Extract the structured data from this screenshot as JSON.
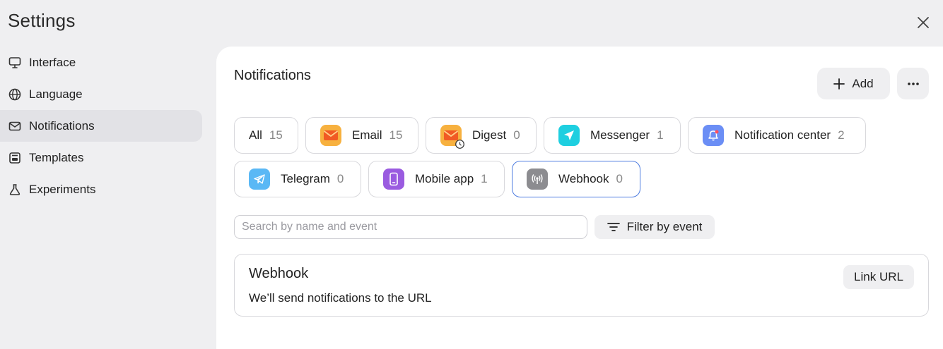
{
  "header": {
    "title": "Settings"
  },
  "sidebar": {
    "items": [
      {
        "label": "Interface",
        "icon": "monitor-icon"
      },
      {
        "label": "Language",
        "icon": "globe-icon"
      },
      {
        "label": "Notifications",
        "icon": "envelope-icon",
        "active": true
      },
      {
        "label": "Templates",
        "icon": "template-icon"
      },
      {
        "label": "Experiments",
        "icon": "flask-icon"
      }
    ]
  },
  "main": {
    "title": "Notifications",
    "add_label": "Add",
    "channels": [
      {
        "label": "All",
        "count": "15"
      },
      {
        "label": "Email",
        "count": "15",
        "icon": "email-icon",
        "color": "#f7b13f"
      },
      {
        "label": "Digest",
        "count": "0",
        "icon": "digest-icon",
        "color": "#f7b13f"
      },
      {
        "label": "Messenger",
        "count": "1",
        "icon": "messenger-icon",
        "color": "#1ecfe0"
      },
      {
        "label": "Notification center",
        "count": "2",
        "icon": "bell-icon",
        "color": "#6b8ef5"
      },
      {
        "label": "Telegram",
        "count": "0",
        "icon": "telegram-icon",
        "color": "#5ab8f5"
      },
      {
        "label": "Mobile app",
        "count": "1",
        "icon": "phone-icon",
        "color": "#9a5be0"
      },
      {
        "label": "Webhook",
        "count": "0",
        "icon": "webhook-icon",
        "color": "#8c8c90",
        "selected": true
      }
    ],
    "search": {
      "placeholder": "Search by name and event",
      "value": ""
    },
    "filter_label": "Filter by event",
    "card": {
      "title": "Webhook",
      "description": "We’ll send notifications to the URL",
      "link_label": "Link URL"
    }
  },
  "colors": {
    "accent_border": "#4d7ce0",
    "button_bg": "#efeff1"
  }
}
